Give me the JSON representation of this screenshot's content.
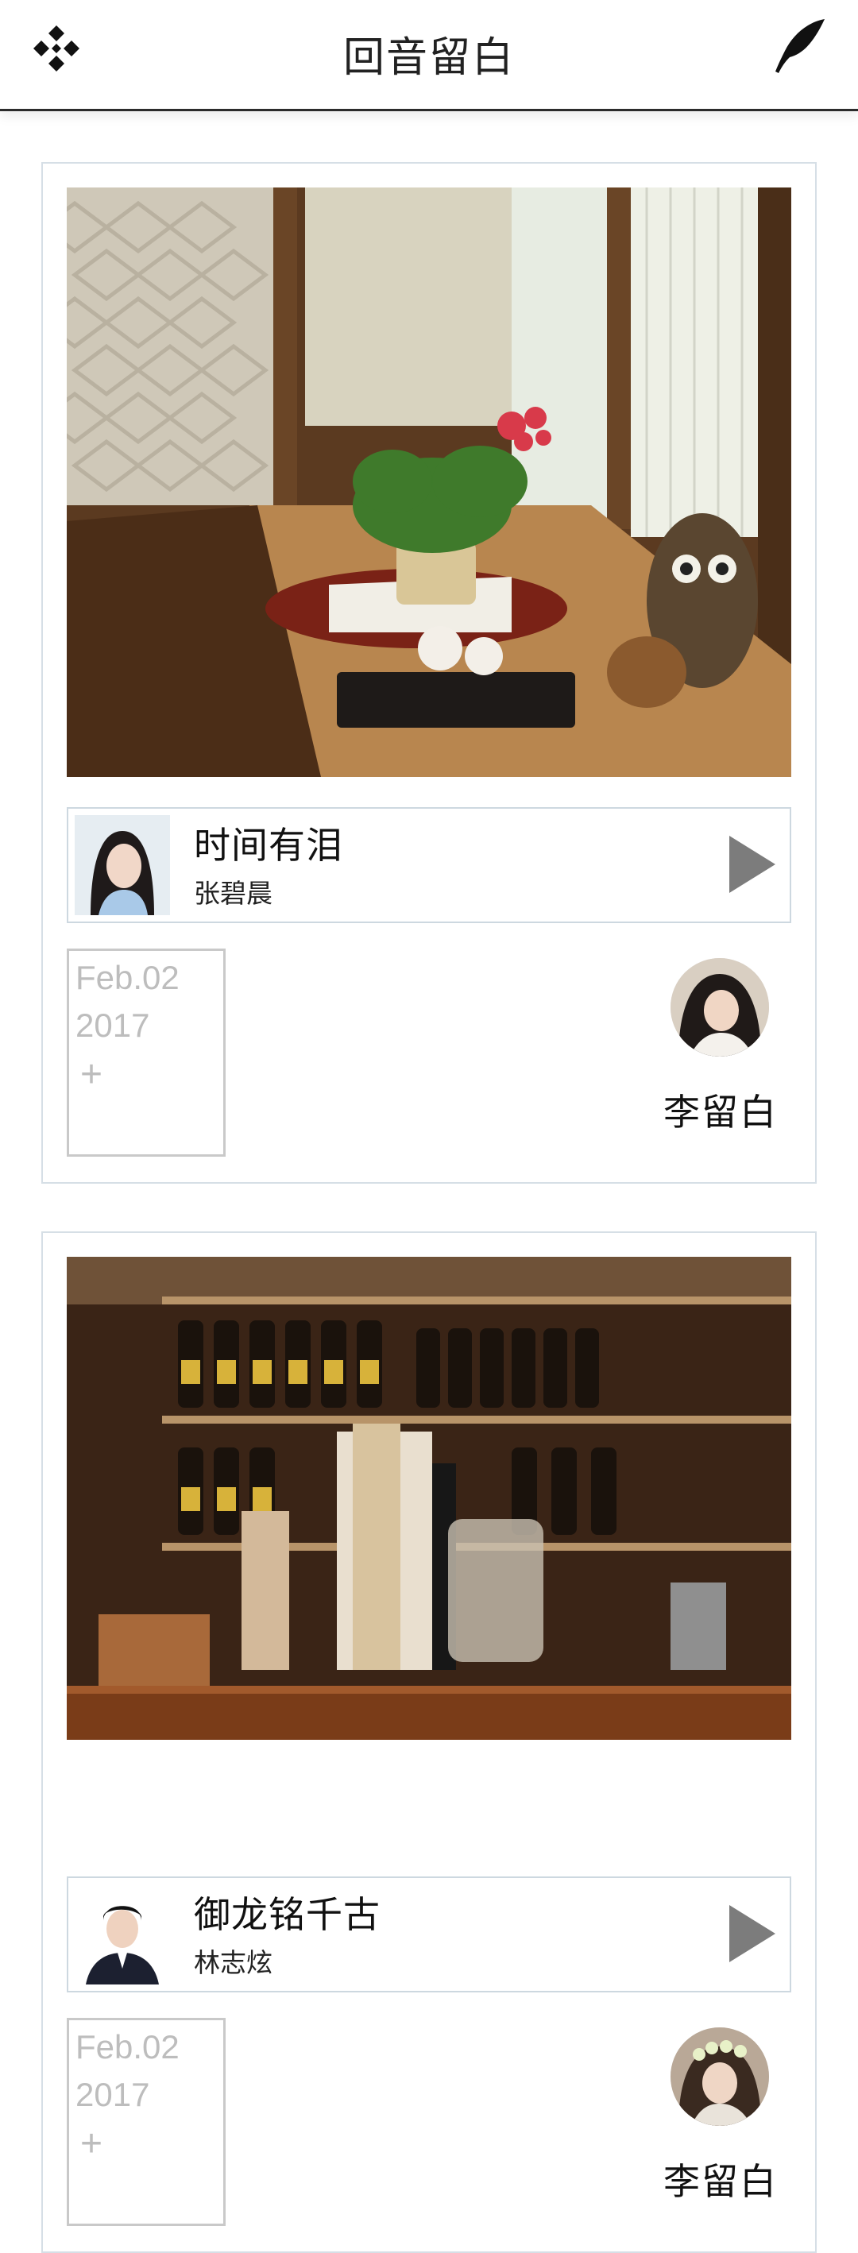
{
  "header": {
    "title": "回音留白",
    "menu_icon": "menu-diamond-icon",
    "write_icon": "feather-pen-icon"
  },
  "posts": [
    {
      "song": {
        "title": "时间有泪",
        "artist": "张碧晨"
      },
      "date": {
        "month_day": "Feb.02",
        "year": "2017",
        "plus": "+"
      },
      "user": {
        "name": "李留白"
      }
    },
    {
      "song": {
        "title": "御龙铭千古",
        "artist": "林志炫"
      },
      "date": {
        "month_day": "Feb.02",
        "year": "2017",
        "plus": "+"
      },
      "user": {
        "name": "李留白"
      }
    }
  ],
  "colors": {
    "card_border": "#d6dfe6",
    "date_text": "#bdbdbd",
    "play_icon": "#7c7c7c"
  }
}
